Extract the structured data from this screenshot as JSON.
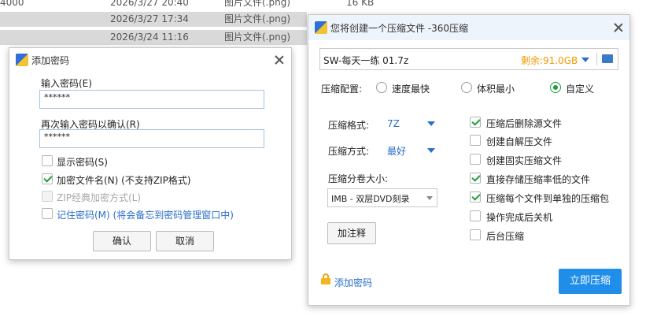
{
  "background_list": {
    "rows": [
      {
        "size_prefix": "4000",
        "date": "2026/3/27 20:40",
        "type": "图片文件(.png)",
        "size": "16 KB"
      },
      {
        "date": "2026/3/27 17:34",
        "type": "图片文件(.png)"
      },
      {
        "date": "2026/3/24 11:16",
        "type": "图片文件(.png)"
      }
    ]
  },
  "password_dialog": {
    "title": "添加密码",
    "enter_label": "输入密码(E)",
    "enter_underline": "E",
    "enter_value": "******",
    "confirm_label": "再次输入密码以确认(R)",
    "confirm_value": "******",
    "options": [
      {
        "label": "显示密码(S)",
        "checked": false,
        "disabled": false
      },
      {
        "label": "加密文件名(N) (不支持ZIP格式)",
        "checked": true,
        "disabled": false
      },
      {
        "label": "ZIP经典加密方式(L)",
        "checked": false,
        "disabled": true
      },
      {
        "label": "记住密码(M) (将会备忘到密码管理窗口中)",
        "checked": false,
        "disabled": false,
        "link": true
      }
    ],
    "ok_label": "确认",
    "cancel_label": "取消"
  },
  "compress_dialog": {
    "title": "您将创建一个压缩文件 -360压缩",
    "filename": "SW-每天一练 01.7z",
    "remaining": "剩余:91.0GB",
    "config_label": "压缩配置:",
    "config_options": [
      {
        "label": "速度最快",
        "selected": false
      },
      {
        "label": "体积最小",
        "selected": false
      },
      {
        "label": "自定义",
        "selected": true
      }
    ],
    "format_label": "压缩格式:",
    "format_value": "7Z",
    "method_label": "压缩方式:",
    "method_value": "最好",
    "split_label": "压缩分卷大小:",
    "split_value": "IMB  - 双层DVD刻录",
    "comment_button": "加注释",
    "right_options": [
      {
        "label": "压缩后删除源文件",
        "checked": true
      },
      {
        "label": "创建自解压文件",
        "checked": false
      },
      {
        "label": "创建固实压缩文件",
        "checked": false
      },
      {
        "label": "直接存储压缩率低的文件",
        "checked": true
      },
      {
        "label": "压缩每个文件到单独的压缩包",
        "checked": true
      },
      {
        "label": "操作完成后关机",
        "checked": false
      },
      {
        "label": "后台压缩",
        "checked": false
      }
    ],
    "add_password_link": "添加密码",
    "compress_button": "立即压缩"
  },
  "colors": {
    "accent_blue": "#2a6fc9",
    "primary_button": "#1e8ee8",
    "remaining_orange": "#f39800",
    "check_green": "#1f9e3f"
  }
}
